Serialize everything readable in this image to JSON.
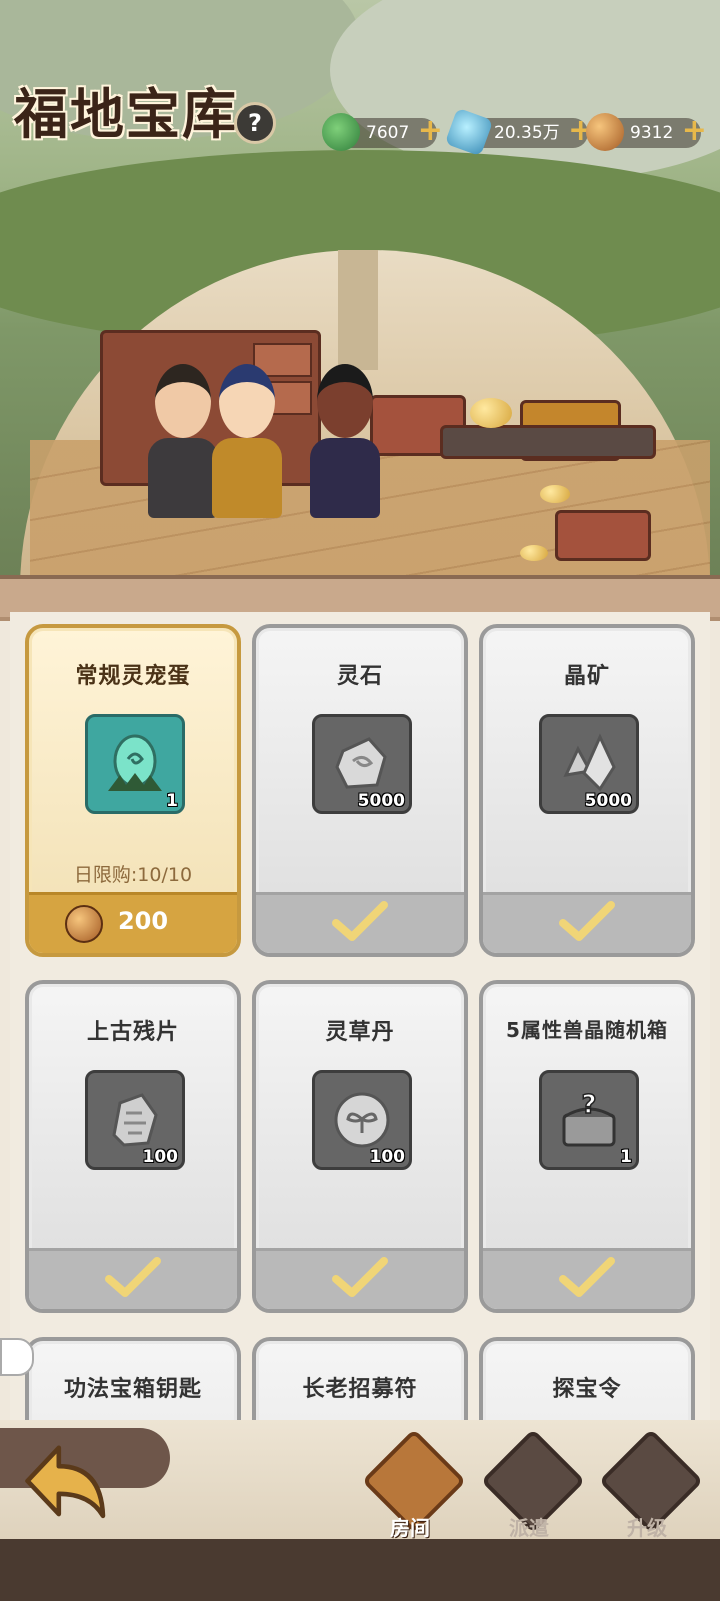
{
  "header": {
    "title": "福地宝库",
    "help_label": "?",
    "resources": [
      {
        "icon": "jade-icon",
        "value": "7607",
        "plus": "+"
      },
      {
        "icon": "spirit-stone-icon",
        "value": "20.35万",
        "plus": "+"
      },
      {
        "icon": "copper-coin-icon",
        "value": "9312",
        "plus": "+"
      }
    ]
  },
  "cards": [
    {
      "name": "常规灵宠蛋",
      "qty": "1",
      "icon": "spirit-pet-egg-icon",
      "limit": "日限购:10/10",
      "price": "200",
      "state": "available"
    },
    {
      "name": "灵石",
      "qty": "5000",
      "icon": "spirit-stone-item-icon",
      "state": "purchased"
    },
    {
      "name": "晶矿",
      "qty": "5000",
      "icon": "crystal-ore-icon",
      "state": "purchased"
    },
    {
      "name": "上古残片",
      "qty": "100",
      "icon": "ancient-fragment-icon",
      "state": "purchased"
    },
    {
      "name": "灵草丹",
      "qty": "100",
      "icon": "herb-pill-icon",
      "state": "purchased"
    },
    {
      "name": "5属性兽晶随机箱",
      "qty": "1",
      "icon": "mystery-chest-icon",
      "state": "purchased"
    },
    {
      "name": "功法宝箱钥匙",
      "state": "partial"
    },
    {
      "name": "长老招募符",
      "state": "partial"
    },
    {
      "name": "探宝令",
      "state": "partial"
    }
  ],
  "nav": {
    "back": "back-arrow-icon",
    "tabs": [
      {
        "label": "房间",
        "icon": "room-icon",
        "active": true
      },
      {
        "label": "派遣",
        "icon": "flag-icon",
        "active": false
      },
      {
        "label": "升级",
        "icon": "upgrade-arrow-icon",
        "active": false
      }
    ]
  },
  "colors": {
    "gold_card": "#c6993f",
    "gray_card": "#9a9a9a",
    "accent": "#e7b84b"
  }
}
